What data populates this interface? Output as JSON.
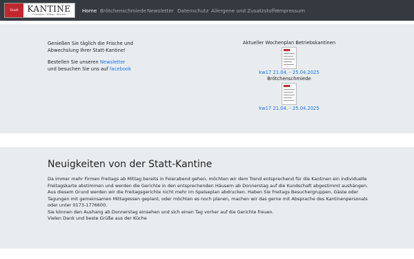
{
  "brand": {
    "logo_title": "KANTINE",
    "logo_badge": "Statt",
    "logo_sub": "Frühstück · Mittag · Kuchen"
  },
  "nav": {
    "items": [
      {
        "label": "Home",
        "active": true
      },
      {
        "label": "Brötchenschmiede",
        "active": false
      },
      {
        "label": "Newsletter",
        "active": false
      },
      {
        "label": "Datenschutz",
        "active": false
      },
      {
        "label": "Allergene und Zusatzstoffe",
        "active": false
      },
      {
        "label": "Impressum",
        "active": false
      }
    ]
  },
  "intro": {
    "line1": "Genießen Sie täglich die Frische und Abwechslung Ihrer Statt-Kantine!",
    "order_prefix": "Bestellen Sie unseren ",
    "newsletter_link": "Newsletter",
    "visit_prefix": "und besuchen Sie uns auf ",
    "facebook_link": "facebook"
  },
  "plans": [
    {
      "title": "Aktueller Wochenplan Betriebskantinen",
      "link": "kw17 21.04. - 25.04.2025"
    },
    {
      "title": "Brötchenschmiede",
      "link": "kw17 21.04. - 25.04.2025"
    }
  ],
  "news": {
    "heading": "Neuigkeiten von der Statt-Kantine",
    "paragraphs": [
      "Da immer mehr Firmen Freitags ab Mittag bereits in Feierabend gehen, möchten wir dem Trend entsprechend für die Kantinen ein individuelle Freitagskarte abstimmen und werden die Gerichte in den entsprechenden Häusern ab Donnerstag auf die Kundschaft abgestimmt aushängen. Aus diesem Grund werden wir die Freitagsgerichte nicht mehr im Speiseplan abdrucken. Haben Sie Freitags Besuchergruppen, Gäste oder Tagungen mit gemeinsamen Mittagessen geplant, oder möchten es noch planen, machen wir das gerne mit Absprache des Kantinenpersonals oder unter 0173-1776600.",
      "Sie können den Aushang ab Donnerstag einsehen und sich einen Tag vorher auf die Gerichte freuen.",
      "Vielen Dank und beste Grüße aus der Küche"
    ]
  },
  "colors": {
    "navbar": "#343a40",
    "section_bg": "#e9ecef",
    "link": "#1a73e8",
    "logo_red": "#c0282d"
  }
}
